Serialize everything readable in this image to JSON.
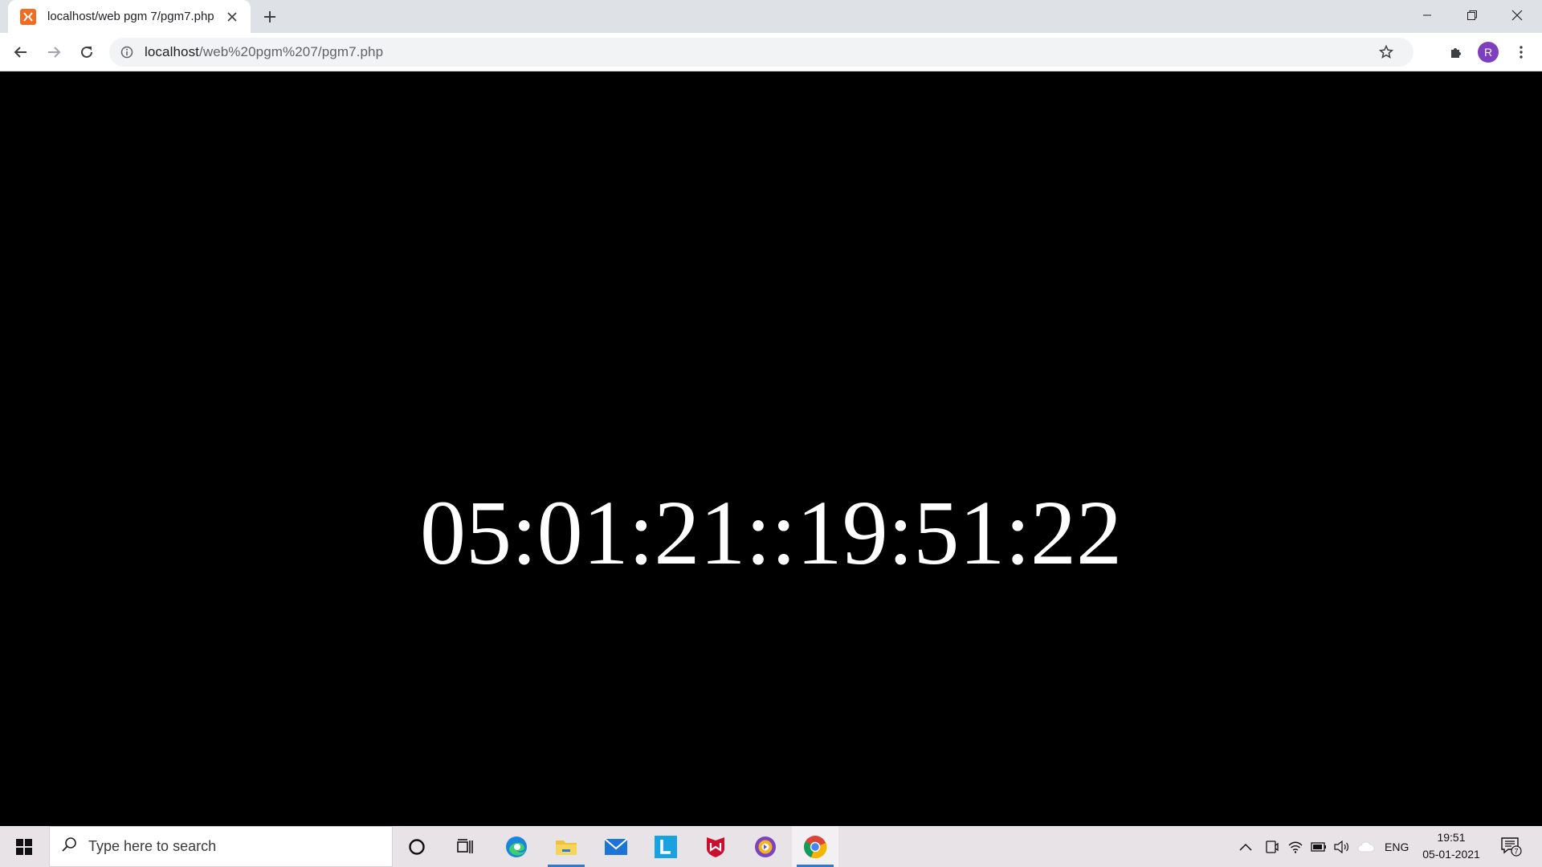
{
  "browser": {
    "tab_title": "localhost/web pgm 7/pgm7.php",
    "url_host": "localhost",
    "url_path": "/web%20pgm%207/pgm7.php",
    "profile_initial": "R"
  },
  "page": {
    "clock_text": "05:01:21::19:51:22"
  },
  "taskbar": {
    "search_placeholder": "Type here to search",
    "language": "ENG",
    "time": "19:51",
    "date": "05-01-2021",
    "notification_count": "7"
  },
  "colors": {
    "page_background": "#000000",
    "clock_text": "#ffffff",
    "xampp_orange": "#f26b22",
    "profile_purple": "#7e3fbf"
  }
}
